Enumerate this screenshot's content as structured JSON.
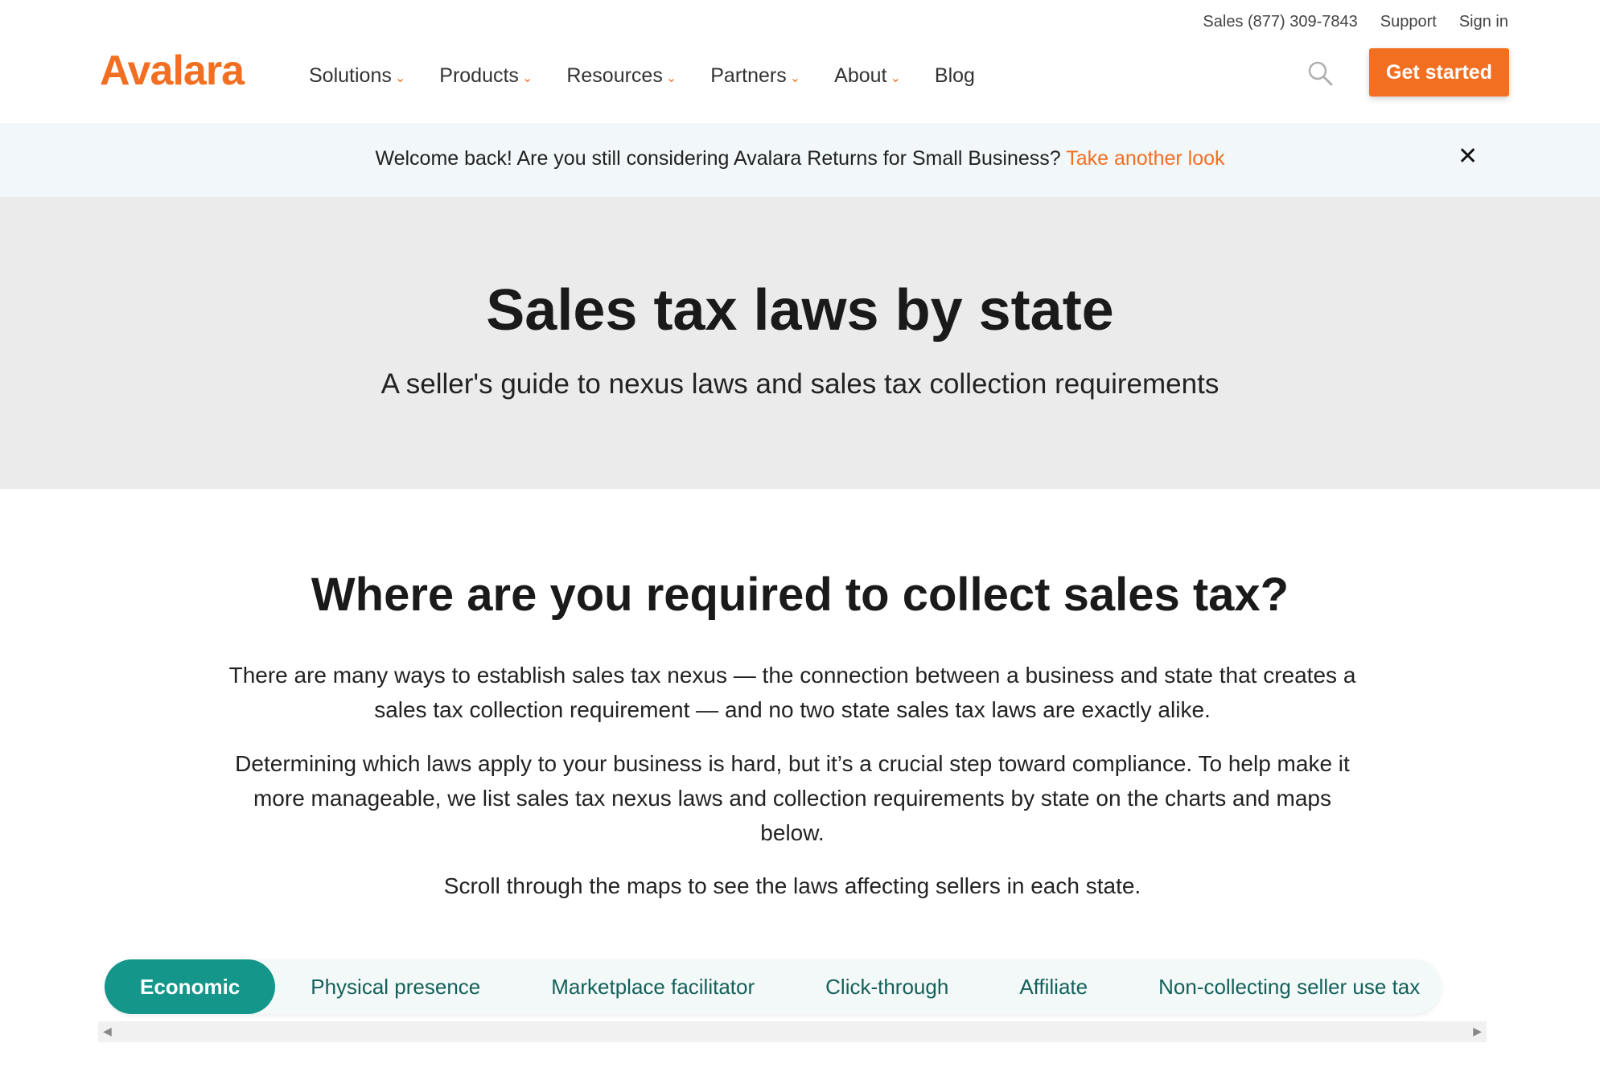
{
  "header": {
    "logo_text": "Avalara",
    "utility": {
      "sales": "Sales (877) 309-7843",
      "support": "Support",
      "sign_in": "Sign in"
    },
    "nav": [
      {
        "label": "Solutions",
        "has_dropdown": true
      },
      {
        "label": "Products",
        "has_dropdown": true
      },
      {
        "label": "Resources",
        "has_dropdown": true
      },
      {
        "label": "Partners",
        "has_dropdown": true
      },
      {
        "label": "About",
        "has_dropdown": true
      },
      {
        "label": "Blog",
        "has_dropdown": false
      }
    ],
    "search_icon": "search-icon",
    "cta_label": "Get started"
  },
  "banner": {
    "text": "Welcome back! Are you still considering Avalara Returns for Small Business?",
    "link": "Take another look",
    "close_icon": "close-icon"
  },
  "hero": {
    "title": "Sales tax laws by state",
    "subtitle": "A seller's guide to nexus laws and sales tax collection requirements"
  },
  "main": {
    "title": "Where are you required to collect sales tax?",
    "paragraphs": [
      "There are many ways to establish sales tax nexus — the connection between a business and state that creates a sales tax collection requirement — and no two state sales tax laws are exactly alike.",
      "Determining which laws apply to your business is hard, but it’s a crucial step toward compliance. To help make it more manageable, we list sales tax nexus laws and collection requirements by state on the charts and maps below.",
      "Scroll through the maps to see the laws affecting sellers in each state."
    ]
  },
  "tabs": {
    "items": [
      "Economic",
      "Physical presence",
      "Marketplace facilitator",
      "Click-through",
      "Affiliate",
      "Non-collecting seller use tax"
    ],
    "active": "Economic"
  },
  "colors": {
    "brand_orange": "#f26f21",
    "tab_teal": "#14968a",
    "tab_text": "#14605a",
    "hero_bg": "#ebebeb",
    "banner_bg": "#f2f7f9"
  }
}
